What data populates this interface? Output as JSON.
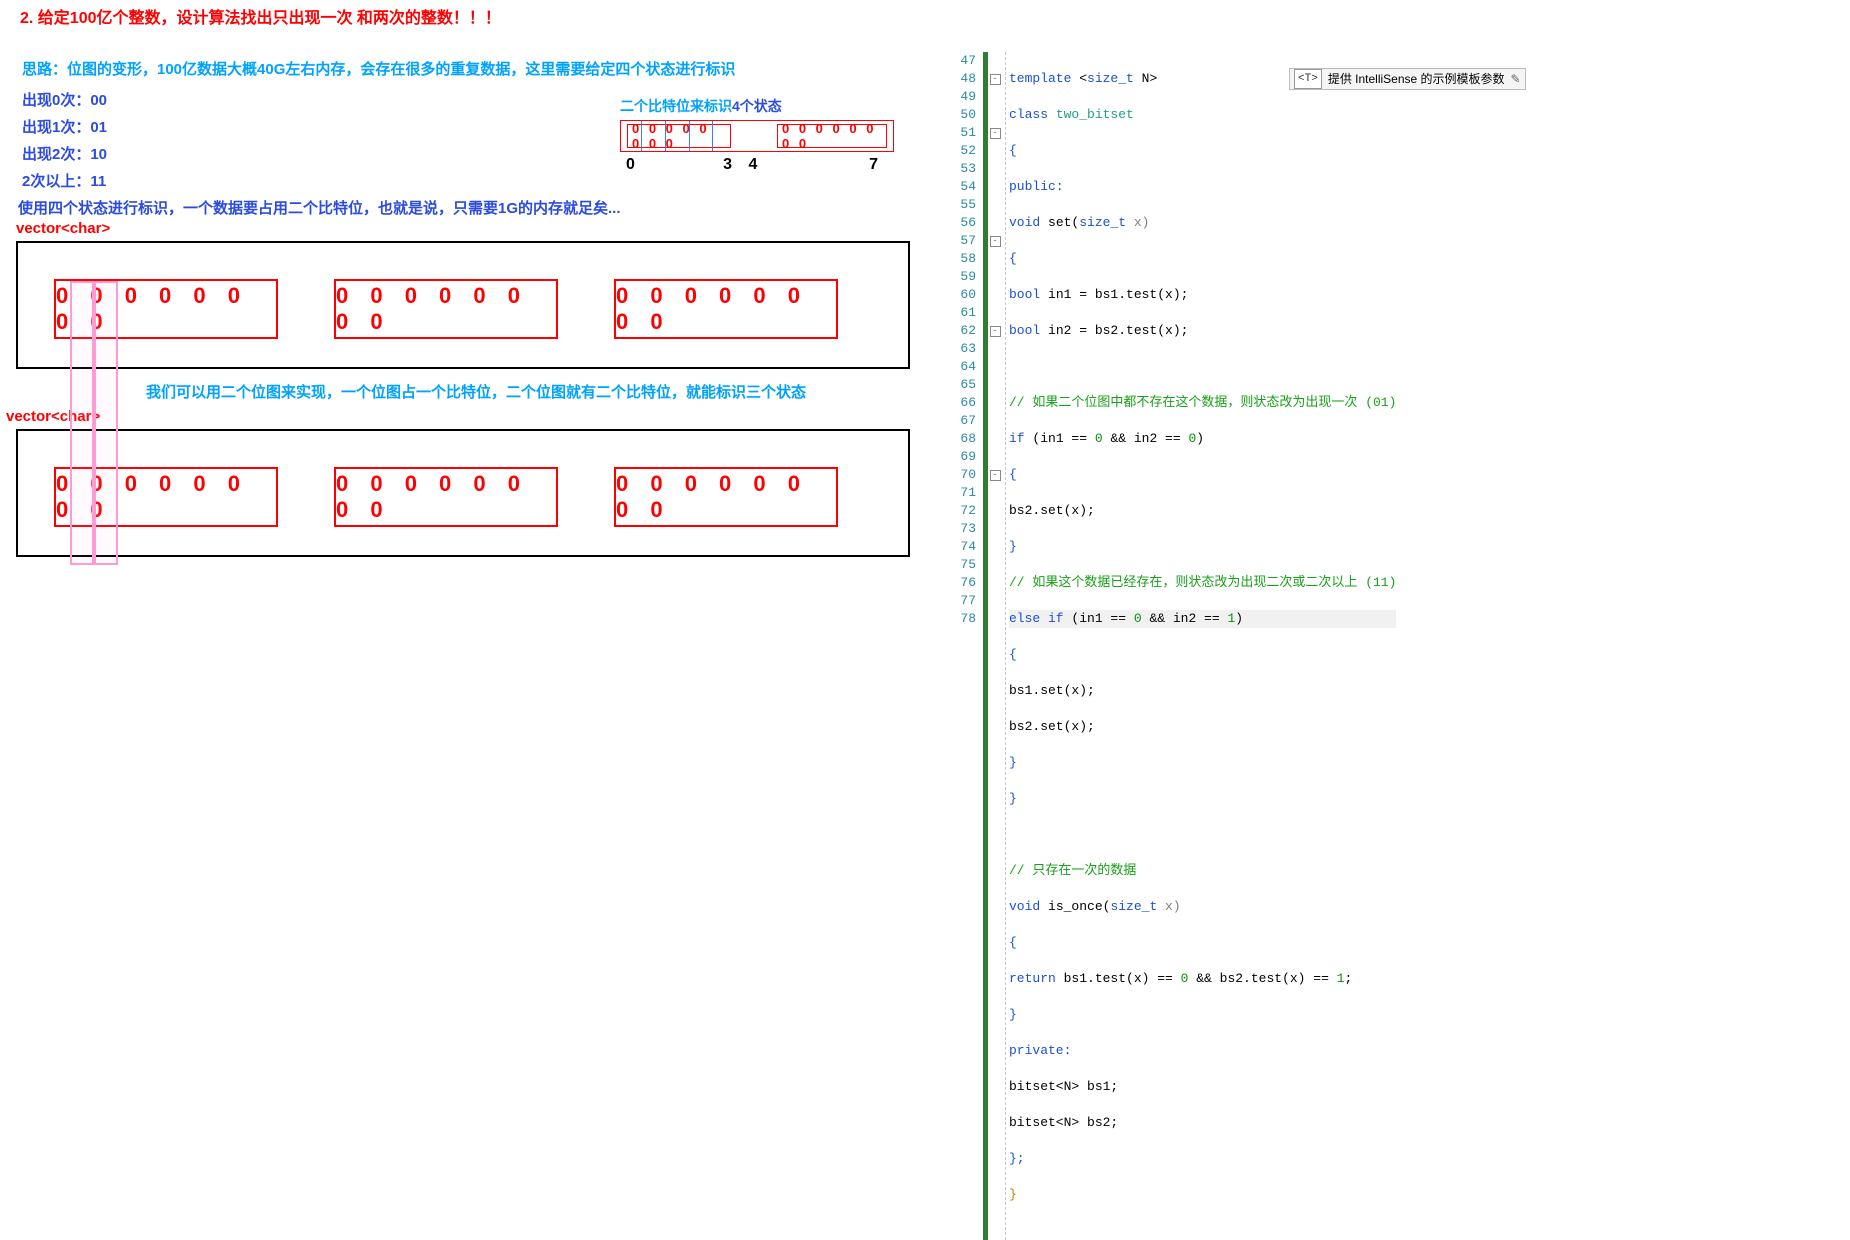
{
  "title": "2. 给定100亿个整数，设计算法找出只出现一次 和两次的整数！！！",
  "idea": "思路：位图的变形，100亿数据大概40G左右内存，会存在很多的重复数据，这里需要给定四个状态进行标识",
  "states": [
    "出现0次：00",
    "出现1次：01",
    "出现2次：10",
    "2次以上：11"
  ],
  "use_line": "使用四个状态进行标识，一个数据要占用二个比特位，也就是说，只需要1G的内存就足矣...",
  "vchar": "vector<char>",
  "mini_caption_a": "二个比特位来标识",
  "mini_caption_b": "4个状态",
  "mini_box_left": "0 0 0 0 0 0 0 0",
  "mini_box_right": "0 0 0 0 0 0 0 0",
  "mini_nums": [
    "0",
    "3",
    "4",
    "7"
  ],
  "byte_text": "0 0 0 0 0 0 0 0",
  "caption_mid": "我们可以用二个位图来实现，一个位图占一个比特位，二个位图就有二个比特位，就能标识三个状态",
  "vchar2": "vector<char>",
  "code": {
    "lines": [
      47,
      48,
      49,
      50,
      51,
      52,
      53,
      54,
      55,
      56,
      57,
      58,
      59,
      60,
      61,
      62,
      63,
      64,
      65,
      66,
      67,
      68,
      69,
      70,
      71,
      72,
      73,
      74,
      75,
      76,
      77,
      78
    ],
    "fold": {
      "48": "-",
      "51": "-",
      "57": "-",
      "62": "-",
      "70": "-"
    },
    "tooltip": {
      "tag": "<T>",
      "text": "提供 IntelliSense 的示例模板参数",
      "pen": "✎"
    },
    "c47": {
      "a": "template",
      "b": " <",
      "c": "size_t",
      "d": " N>"
    },
    "c48": {
      "a": "class",
      "b": " two_bitset"
    },
    "c49": "{",
    "c50": "public:",
    "c51": {
      "a": "void",
      "b": " set(",
      "c": "size_t",
      "d": " x)"
    },
    "c52": "{",
    "c53": {
      "a": "bool",
      "b": " in1 = bs1.test(x);"
    },
    "c54": {
      "a": "bool",
      "b": " in2 = bs2.test(x);"
    },
    "c56": "// 如果二个位图中都不存在这个数据，则状态改为出现一次 (01)",
    "c57": {
      "a": "if",
      "b": " (in1 == ",
      "c": "0",
      "d": " && in2 == ",
      "e": "0",
      "f": ")"
    },
    "c58": "{",
    "c59": "bs2.set(x);",
    "c60": "}",
    "c61": "// 如果这个数据已经存在，则状态改为出现二次或二次以上 (11)",
    "c62": {
      "a": "else if",
      "b": " (in1 == ",
      "c": "0",
      "d": " && in2 == ",
      "e": "1",
      "f": ")"
    },
    "c63": "{",
    "c64": "bs1.set(x);",
    "c65": "bs2.set(x);",
    "c66": "}",
    "c67": "}",
    "c69": "// 只存在一次的数据",
    "c70": {
      "a": "void",
      "b": " is_once(",
      "c": "size_t",
      "d": " x)"
    },
    "c71": "{",
    "c72": {
      "a": "return",
      "b": " bs1.test(x) == ",
      "c": "0",
      "d": " && bs2.test(x) == ",
      "e": "1",
      "f": ";"
    },
    "c73": "}",
    "c74": "private:",
    "c75": "bitset<N> bs1;",
    "c76": "bitset<N> bs2;",
    "c77": "};",
    "c78": "}"
  }
}
